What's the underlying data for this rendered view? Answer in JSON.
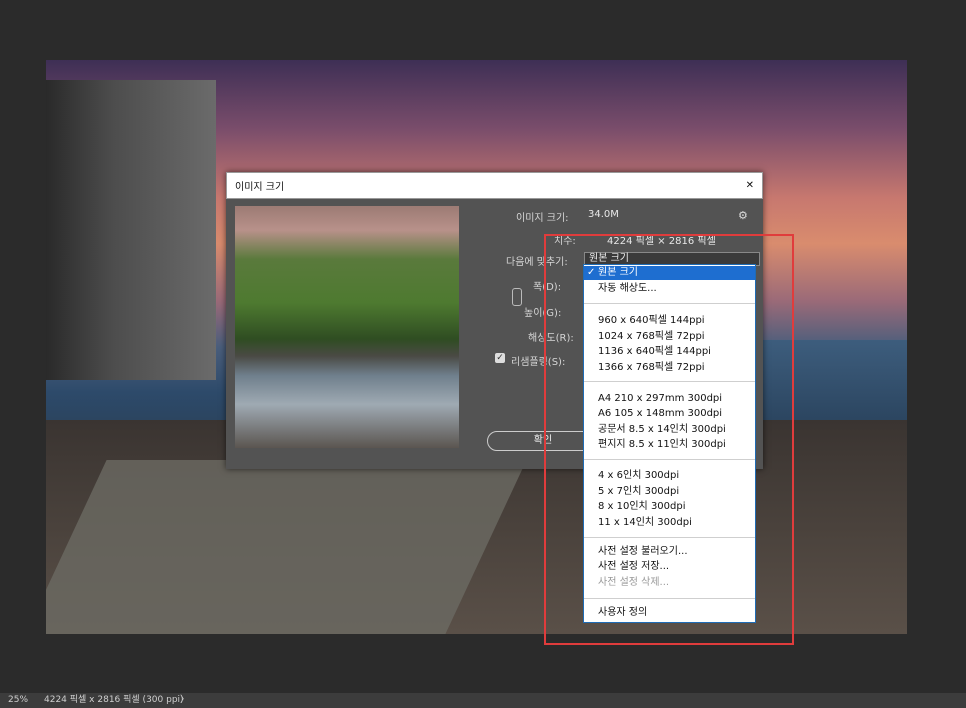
{
  "dialog": {
    "title": "이미지 크기",
    "close": "✕",
    "image_size_label": "이미지 크기:",
    "image_size_value": "34.0M",
    "dimensions_label": "치수:",
    "dimensions_value": "4224 픽셀 × 2816 픽셀",
    "fit_to_label": "다음에 맞추기:",
    "fit_to_value": "원본 크기",
    "width_label": "폭(D):",
    "height_label": "높이(G):",
    "resolution_label": "해상도(R):",
    "resample_label": "리샘플링(S):",
    "ok_label": "확인",
    "gear": "⚙"
  },
  "menu": {
    "items": [
      {
        "label": "원본 크기",
        "selected": true
      },
      {
        "label": "자동 해상도..."
      },
      {
        "label": "960 x 640픽셀 144ppi"
      },
      {
        "label": "1024 x 768픽셀 72ppi"
      },
      {
        "label": "1136 x 640픽셀 144ppi"
      },
      {
        "label": "1366 x 768픽셀 72ppi"
      },
      {
        "label": "A4 210 x 297mm 300dpi"
      },
      {
        "label": "A6 105 x 148mm 300dpi"
      },
      {
        "label": "공문서 8.5 x 14인치 300dpi"
      },
      {
        "label": "편지지 8.5 x 11인치 300dpi"
      },
      {
        "label": "4 x 6인치 300dpi"
      },
      {
        "label": "5 x 7인치 300dpi"
      },
      {
        "label": "8 x 10인치 300dpi"
      },
      {
        "label": "11 x 14인치 300dpi"
      },
      {
        "label": "사전 설정 불러오기..."
      },
      {
        "label": "사전 설정 저장..."
      },
      {
        "label": "사전 설정 삭제...",
        "disabled": true
      },
      {
        "label": "사용자 정의"
      }
    ]
  },
  "status": {
    "zoom": "25%",
    "info": "4224 픽셀 x 2816 픽셀 (300 ppi)",
    "arrow": "〉"
  },
  "colors": {
    "highlight": "#1e6ed0",
    "annotation": "#e03c3c"
  }
}
